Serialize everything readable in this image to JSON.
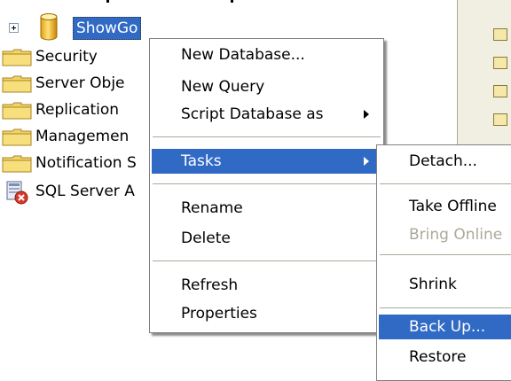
{
  "tree": {
    "database": {
      "label": "ShowGo",
      "icon": "database-cylinder-icon"
    },
    "items": [
      {
        "label": "Security",
        "icon": "folder-icon"
      },
      {
        "label": "Server Obje",
        "icon": "folder-icon"
      },
      {
        "label": "Replication",
        "icon": "folder-icon"
      },
      {
        "label": "Managemen",
        "icon": "folder-icon"
      },
      {
        "label": "Notification S",
        "icon": "folder-icon"
      },
      {
        "label": "SQL Server A",
        "icon": "sql-server-agent-stopped-icon"
      }
    ]
  },
  "context_menu": {
    "items": [
      {
        "label": "New Database..."
      },
      {
        "label": "New Query"
      },
      {
        "label": "Script Database as",
        "submenu": true
      },
      {
        "label": "Tasks",
        "submenu": true,
        "highlighted": true
      },
      {
        "label": "Rename"
      },
      {
        "label": "Delete"
      },
      {
        "label": "Refresh"
      },
      {
        "label": "Properties"
      }
    ]
  },
  "tasks_submenu": {
    "items": [
      {
        "label": "Detach..."
      },
      {
        "label": "Take Offline"
      },
      {
        "label": "Bring Online",
        "disabled": true
      },
      {
        "label": "Shrink"
      },
      {
        "label": "Back Up...",
        "highlighted": true
      },
      {
        "label": "Restore"
      }
    ]
  },
  "colors": {
    "selection": "#316ac5",
    "menu_border": "#808080",
    "separator": "#aca899",
    "disabled_text": "#aca899"
  }
}
